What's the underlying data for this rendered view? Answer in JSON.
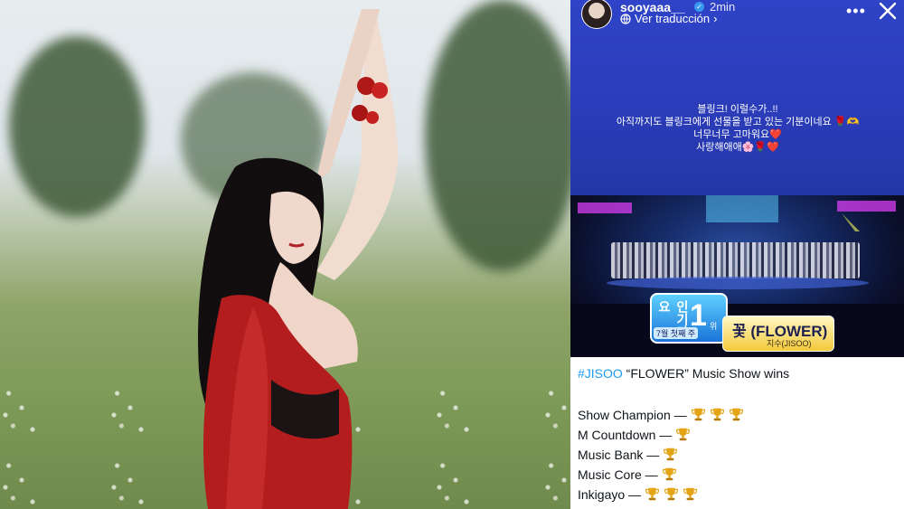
{
  "story": {
    "username": "sooyaaa__",
    "time": "2min",
    "translate_label": "Ver traducción",
    "more_label": "•••",
    "message_lines": [
      "블링크! 이럴수가..!!",
      "아직까지도 블링크에게 선물을 받고 있는 기분이네요 🌹🫶",
      "너무너무 고마워요❤️",
      "사랑해애애🌸🌹❤️"
    ]
  },
  "tv": {
    "rank_label": "인기가요",
    "rank_number": "1",
    "rank_unit": "위",
    "week_label": "7월 첫째 주",
    "song_title": "꽃 (FLOWER)",
    "song_artist": "지수(JISOO)"
  },
  "tweet": {
    "hashtag": "#JISOO",
    "title_rest": " “FLOWER” Music Show wins",
    "wins": [
      {
        "show": "Show Champion —",
        "trophies": 3
      },
      {
        "show": "M Countdown —",
        "trophies": 1
      },
      {
        "show": "Music Bank —",
        "trophies": 1
      },
      {
        "show": "Music Core —",
        "trophies": 1
      },
      {
        "show": "Inkigayo —",
        "trophies": 3
      }
    ]
  },
  "colors": {
    "story_bg": "#2b3dbb",
    "hashtag": "#1d9bf0",
    "trophy": "#e3a516",
    "dress": "#b41d1d"
  }
}
